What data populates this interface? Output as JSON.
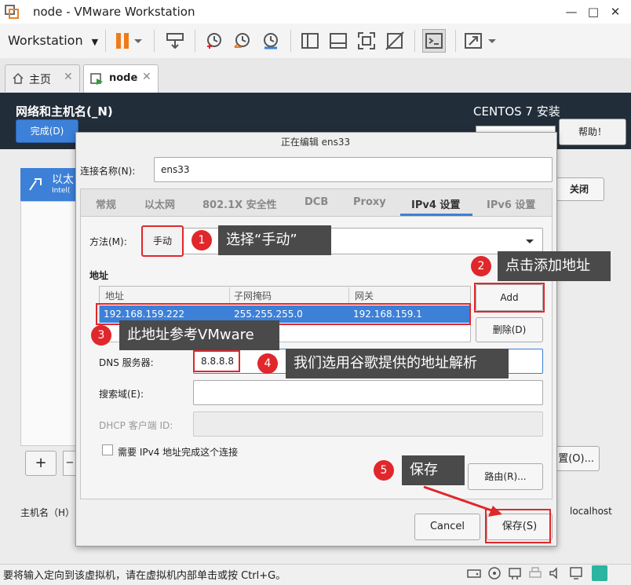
{
  "window": {
    "title": "node - VMware Workstation",
    "controls": [
      "—",
      "□",
      "✕"
    ]
  },
  "toolbar": {
    "menu_label": "Workstation",
    "menu_arrow": "▼",
    "icons": [
      "pause-icon",
      "dropdown-icon",
      "send-keys-icon",
      "snapshot-take-icon",
      "snapshot-revert-icon",
      "snapshot-manager-icon",
      "sidebar-toggle-icon",
      "view-single-icon",
      "fullscreen-icon",
      "unity-icon",
      "console-icon",
      "stretch-icon"
    ]
  },
  "tabs": [
    {
      "label": "主页",
      "icon": "home-icon",
      "close": "✕"
    },
    {
      "label": "node",
      "icon": "vm-running-icon",
      "close": "✕"
    }
  ],
  "installer": {
    "header_title": "网络和主机名(_N)",
    "done_button": "完成(D)",
    "product_title": "CENTOS 7 安装",
    "help_button": "帮助！",
    "nic_label": "以太",
    "nic_sub": "Intel(",
    "close_button": "关闭",
    "config_button": "置(O)...",
    "plus_button": "+",
    "minus_button": "−",
    "hostname_label": "主机名（H）",
    "hostname_value": "localhost"
  },
  "dialog": {
    "title": "正在编辑 ens33",
    "conn_name_label": "连接名称(N):",
    "conn_name_value": "ens33",
    "tabs": [
      "常规",
      "以太网",
      "802.1X 安全性",
      "DCB",
      "Proxy",
      "IPv4 设置",
      "IPv6 设置"
    ],
    "active_tab": "IPv4 设置",
    "method_label": "方法(M):",
    "method_value": "手动",
    "addresses_label": "地址",
    "table_headers": [
      "地址",
      "子网掩码",
      "网关"
    ],
    "table_rows": [
      [
        "192.168.159.222",
        "255.255.255.0",
        "192.168.159.1"
      ]
    ],
    "add_button": "Add",
    "delete_button": "删除(D)",
    "dns_label": "DNS 服务器:",
    "dns_value": "8.8.8.8",
    "search_label": "搜索域(E):",
    "dhcp_label": "DHCP 客户端 ID:",
    "require_checkbox_label": "需要 IPv4 地址完成这个连接",
    "routes_button": "路由(R)...",
    "cancel_button": "Cancel",
    "save_button": "保存(S)"
  },
  "annotations": [
    {
      "num": "1",
      "text": "选择“手动”"
    },
    {
      "num": "2",
      "text": "点击添加地址"
    },
    {
      "num": "3",
      "text": "此地址参考VMware"
    },
    {
      "num": "4",
      "text": "我们选用谷歌提供的地址解析"
    },
    {
      "num": "5",
      "text": "保存"
    }
  ],
  "statusbar": {
    "text": "要将输入定向到该虚拟机，请在虚拟机内部单击或按 Ctrl+G。",
    "icons": [
      "hdd-icon",
      "cdrom-icon",
      "network-icon",
      "printer-icon",
      "sound-icon",
      "display-icon",
      "message-icon"
    ]
  },
  "colors": {
    "accent": "#3d80d8",
    "annotation_red": "#e0272b",
    "callout_bg": "#4a4a4a",
    "header_bg": "#222d3a"
  }
}
